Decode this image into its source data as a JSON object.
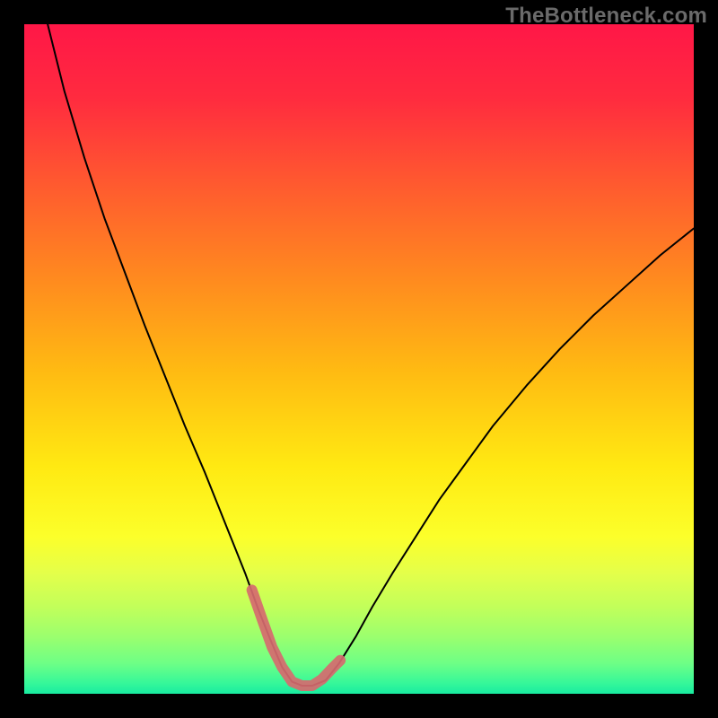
{
  "watermark": "TheBottleneck.com",
  "chart_data": {
    "type": "line",
    "title": "",
    "xlabel": "",
    "ylabel": "",
    "xlim": [
      0,
      100
    ],
    "ylim": [
      0,
      100
    ],
    "grid": false,
    "legend": false,
    "gradient_stops": [
      {
        "offset": 0.0,
        "color": "#ff1747"
      },
      {
        "offset": 0.11,
        "color": "#ff2b3f"
      },
      {
        "offset": 0.24,
        "color": "#ff5a2f"
      },
      {
        "offset": 0.38,
        "color": "#ff8a1f"
      },
      {
        "offset": 0.52,
        "color": "#ffbb12"
      },
      {
        "offset": 0.66,
        "color": "#ffe912"
      },
      {
        "offset": 0.765,
        "color": "#fcff2a"
      },
      {
        "offset": 0.82,
        "color": "#e4ff4a"
      },
      {
        "offset": 0.87,
        "color": "#c2ff5a"
      },
      {
        "offset": 0.915,
        "color": "#9bff6e"
      },
      {
        "offset": 0.955,
        "color": "#6dff86"
      },
      {
        "offset": 0.985,
        "color": "#34f79a"
      },
      {
        "offset": 1.0,
        "color": "#18eca0"
      }
    ],
    "series": [
      {
        "name": "bottleneck-curve",
        "color": "#000000",
        "stroke_width": 2,
        "x": [
          3.5,
          6.0,
          9.0,
          12.0,
          15.0,
          18.0,
          21.0,
          24.0,
          27.0,
          29.0,
          31.0,
          33.0,
          35.0,
          36.8,
          38.5,
          40.0,
          41.5,
          43.0,
          45.0,
          47.0,
          49.5,
          52.0,
          55.0,
          58.5,
          62.0,
          66.0,
          70.0,
          75.0,
          80.0,
          85.0,
          90.0,
          95.0,
          100.0
        ],
        "y": [
          100.0,
          90.0,
          80.0,
          71.0,
          63.0,
          55.0,
          47.5,
          40.0,
          33.0,
          28.0,
          23.0,
          18.0,
          12.5,
          8.0,
          4.0,
          1.8,
          1.2,
          1.2,
          2.0,
          4.5,
          8.5,
          13.0,
          18.0,
          23.5,
          29.0,
          34.5,
          40.0,
          46.0,
          51.5,
          56.5,
          61.0,
          65.5,
          69.5
        ]
      },
      {
        "name": "highlight-band",
        "color": "#d66a6f",
        "stroke_width": 12,
        "x": [
          34.0,
          35.5,
          37.0,
          38.5,
          40.0,
          41.5,
          43.0,
          44.5,
          46.0,
          47.2
        ],
        "y": [
          15.5,
          11.2,
          7.0,
          4.0,
          1.8,
          1.2,
          1.2,
          2.2,
          3.8,
          5.0
        ]
      }
    ]
  }
}
